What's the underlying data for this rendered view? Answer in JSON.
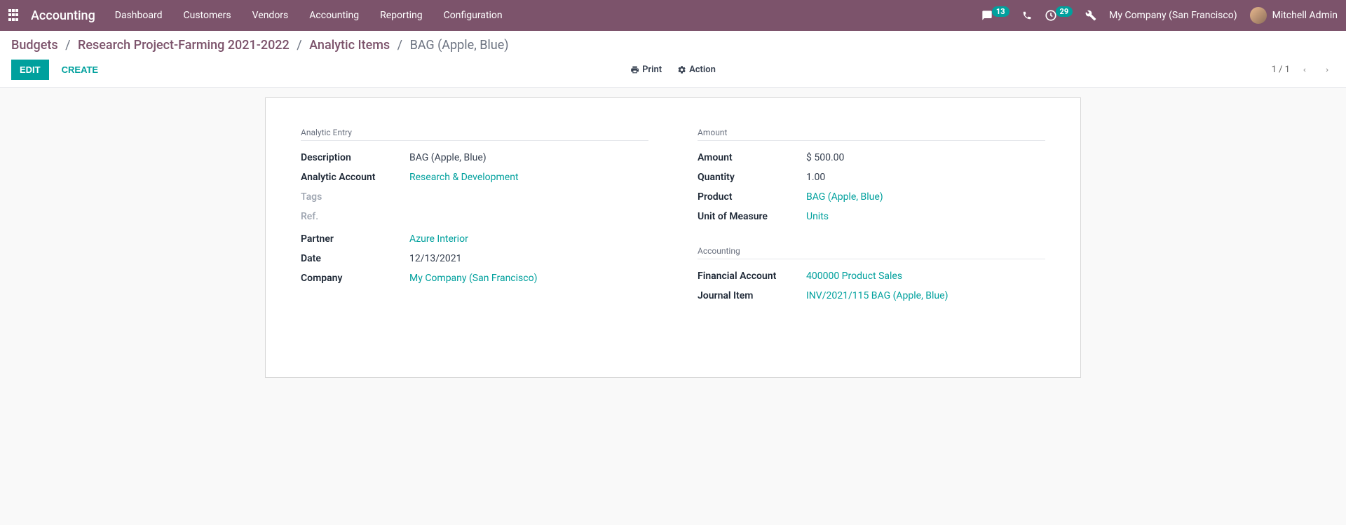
{
  "header": {
    "app_title": "Accounting",
    "nav": [
      "Dashboard",
      "Customers",
      "Vendors",
      "Accounting",
      "Reporting",
      "Configuration"
    ],
    "messages_count": "13",
    "activities_count": "29",
    "company": "My Company (San Francisco)",
    "user": "Mitchell Admin"
  },
  "breadcrumb": {
    "items": [
      "Budgets",
      "Research Project-Farming 2021-2022",
      "Analytic Items"
    ],
    "current": "BAG (Apple, Blue)"
  },
  "controls": {
    "edit": "Edit",
    "create": "Create",
    "print": "Print",
    "action": "Action",
    "pager": "1 / 1"
  },
  "left": {
    "group1_title": "Analytic Entry",
    "description_label": "Description",
    "description_value": "BAG (Apple, Blue)",
    "analytic_account_label": "Analytic Account",
    "analytic_account_value": "Research & Development",
    "tags_label": "Tags",
    "ref_label": "Ref.",
    "partner_label": "Partner",
    "partner_value": "Azure Interior",
    "date_label": "Date",
    "date_value": "12/13/2021",
    "company_label": "Company",
    "company_value": "My Company (San Francisco)"
  },
  "right": {
    "group1_title": "Amount",
    "amount_label": "Amount",
    "amount_value": "$ 500.00",
    "quantity_label": "Quantity",
    "quantity_value": "1.00",
    "product_label": "Product",
    "product_value": "BAG (Apple, Blue)",
    "uom_label": "Unit of Measure",
    "uom_value": "Units",
    "group2_title": "Accounting",
    "fin_account_label": "Financial Account",
    "fin_account_value": "400000 Product Sales",
    "journal_label": "Journal Item",
    "journal_value": "INV/2021/115 BAG (Apple, Blue)"
  }
}
